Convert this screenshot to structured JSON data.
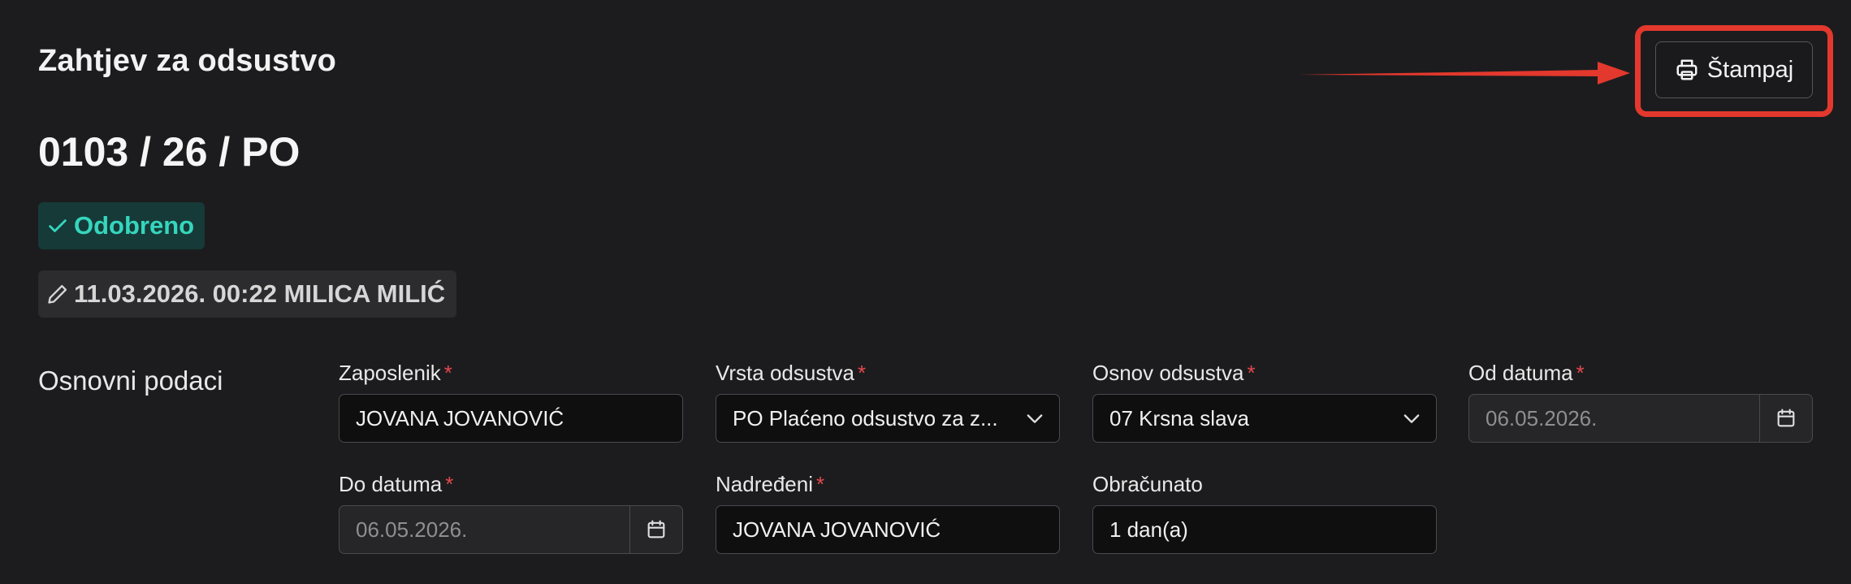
{
  "header": {
    "title": "Zahtjev za odsustvo",
    "print_label": "Štampaj"
  },
  "request": {
    "number": "0103 / 26 / PO",
    "status": "Odobreno",
    "modified_info": "11.03.2026. 00:22 MILICA MILIĆ"
  },
  "section": {
    "title": "Osnovni podaci"
  },
  "fields": {
    "employee": {
      "label": "Zaposlenik",
      "value": "JOVANA JOVANOVIĆ",
      "required": "*"
    },
    "leave_type": {
      "label": "Vrsta odsustva",
      "value": "PO Plaćeno odsustvo za z...",
      "required": "*"
    },
    "leave_reason": {
      "label": "Osnov odsustva",
      "value": "07 Krsna slava",
      "required": "*"
    },
    "date_from": {
      "label": "Od datuma",
      "value": "06.05.2026.",
      "required": "*"
    },
    "date_to": {
      "label": "Do datuma",
      "value": "06.05.2026.",
      "required": "*"
    },
    "supervisor": {
      "label": "Nadređeni",
      "value": "JOVANA JOVANOVIĆ",
      "required": "*"
    },
    "calculated": {
      "label": "Obračunato",
      "value": "1 dan(a)"
    }
  },
  "colors": {
    "background": "#1c1c1e",
    "status_green": "#35d6bd",
    "required_red": "#e5484d",
    "annotation_red": "#e3382d"
  },
  "icons": {
    "print": "printer-icon",
    "status": "check-icon",
    "modified": "pencil-icon",
    "dropdown": "chevron-down-icon",
    "date": "calendar-icon"
  }
}
